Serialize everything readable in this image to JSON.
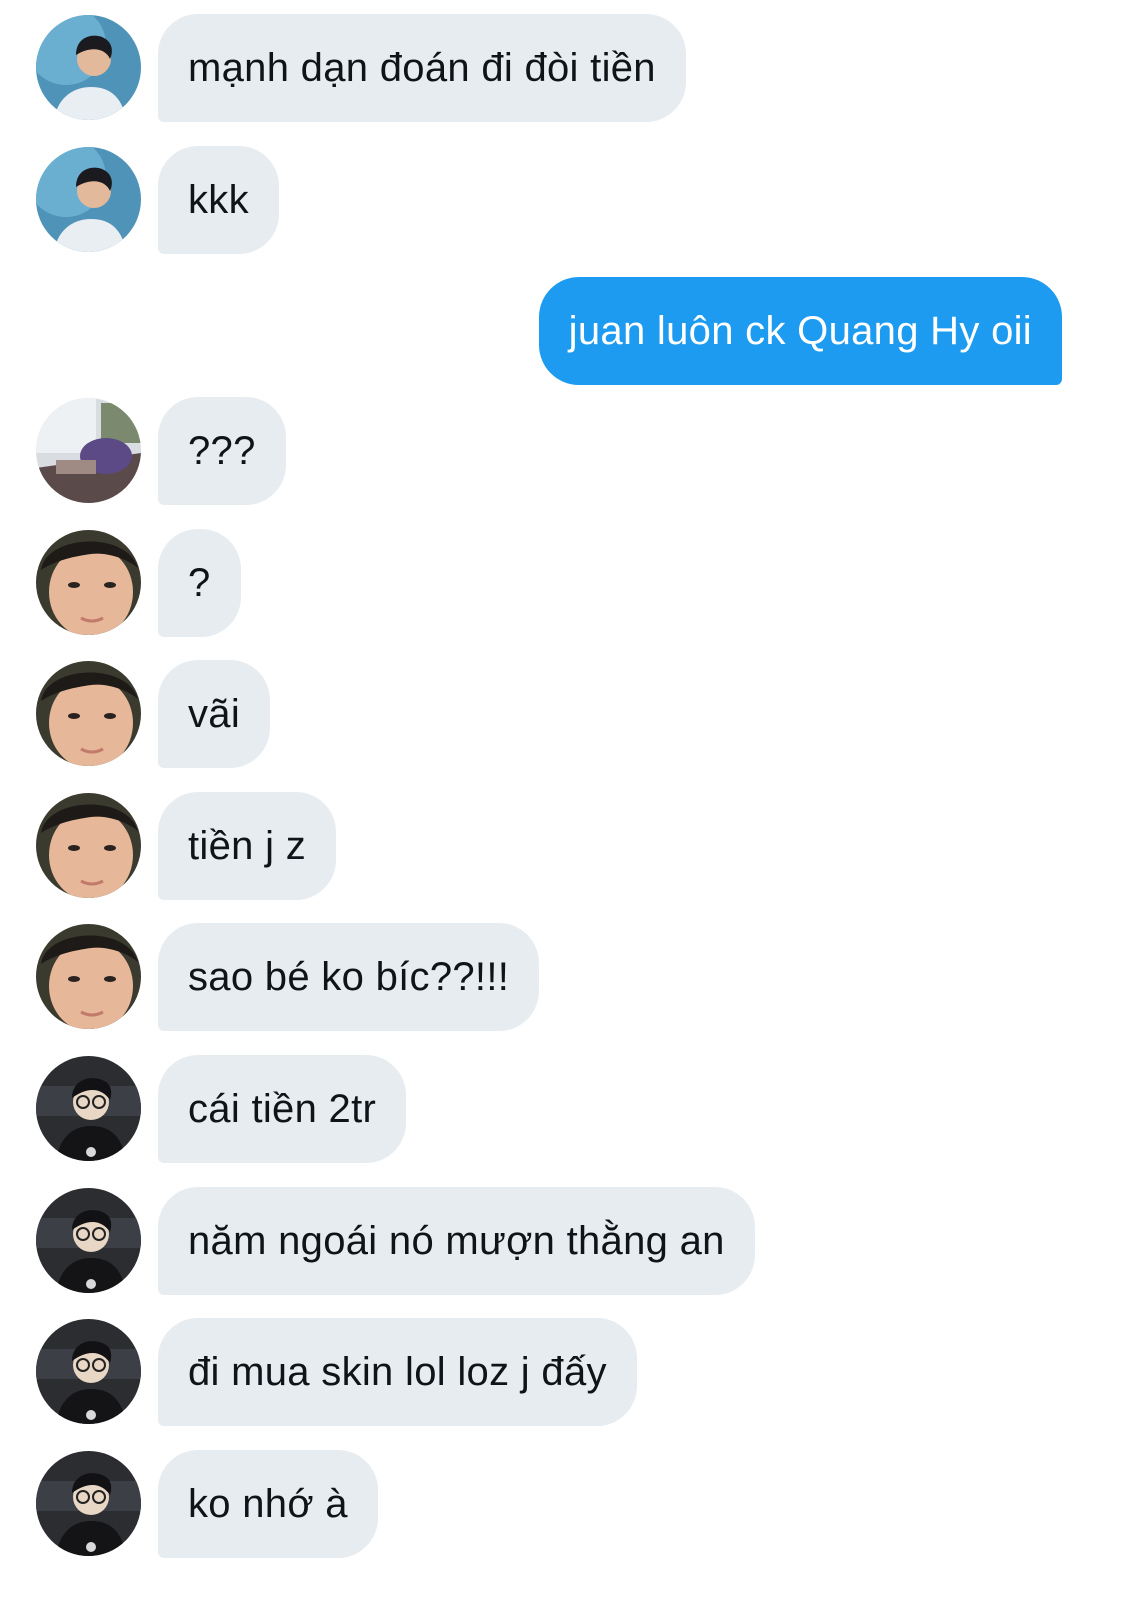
{
  "colors": {
    "incoming_bubble": "#e7ecf0",
    "outgoing_bubble": "#1d9bf0",
    "incoming_text": "#0f1419",
    "outgoing_text": "#ffffff"
  },
  "messages": [
    {
      "text": "mạnh dạn đoán đi đòi tiền",
      "direction": "incoming",
      "avatar": "user-avatar-sky"
    },
    {
      "text": "kkk",
      "direction": "incoming",
      "avatar": "user-avatar-sky"
    },
    {
      "text": "juan luôn ck Quang Hy oii",
      "direction": "outgoing",
      "avatar": null
    },
    {
      "text": "???",
      "direction": "incoming",
      "avatar": "user-avatar-room"
    },
    {
      "text": "?",
      "direction": "incoming",
      "avatar": "user-avatar-face"
    },
    {
      "text": "vãi",
      "direction": "incoming",
      "avatar": "user-avatar-face"
    },
    {
      "text": "tiền j z",
      "direction": "incoming",
      "avatar": "user-avatar-face"
    },
    {
      "text": "sao bé ko bíc??!!!",
      "direction": "incoming",
      "avatar": "user-avatar-face"
    },
    {
      "text": "cái tiền 2tr",
      "direction": "incoming",
      "avatar": "user-avatar-gamer"
    },
    {
      "text": "năm ngoái nó mượn thằng an",
      "direction": "incoming",
      "avatar": "user-avatar-gamer"
    },
    {
      "text": "đi mua skin lol loz j đấy",
      "direction": "incoming",
      "avatar": "user-avatar-gamer"
    },
    {
      "text": "ko nhớ à",
      "direction": "incoming",
      "avatar": "user-avatar-gamer"
    }
  ]
}
